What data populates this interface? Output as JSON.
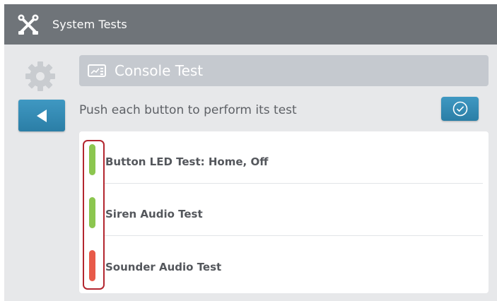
{
  "app": {
    "title": "System Tests",
    "icon": "tools-icon"
  },
  "sidebar": {
    "settings_icon": "gear-icon",
    "back_icon": "triangle-left-icon"
  },
  "header": {
    "icon": "console-icon",
    "title": "Console Test"
  },
  "instruction": "Push each button to perform its test",
  "confirm_icon": "check-circle-icon",
  "tests": [
    {
      "label": "Button LED Test: Home, Off",
      "status": "pass",
      "color": "#8cc64f"
    },
    {
      "label": "Siren Audio Test",
      "status": "pass",
      "color": "#8cc64f"
    },
    {
      "label": "Sounder Audio Test",
      "status": "fail",
      "color": "#e85a49"
    }
  ],
  "colors": {
    "titlebar": "#6f7479",
    "accent_button": "#2f87b2",
    "header_bar": "#c5c9cf",
    "background": "#e7e8ea",
    "highlight": "#b3262f"
  }
}
